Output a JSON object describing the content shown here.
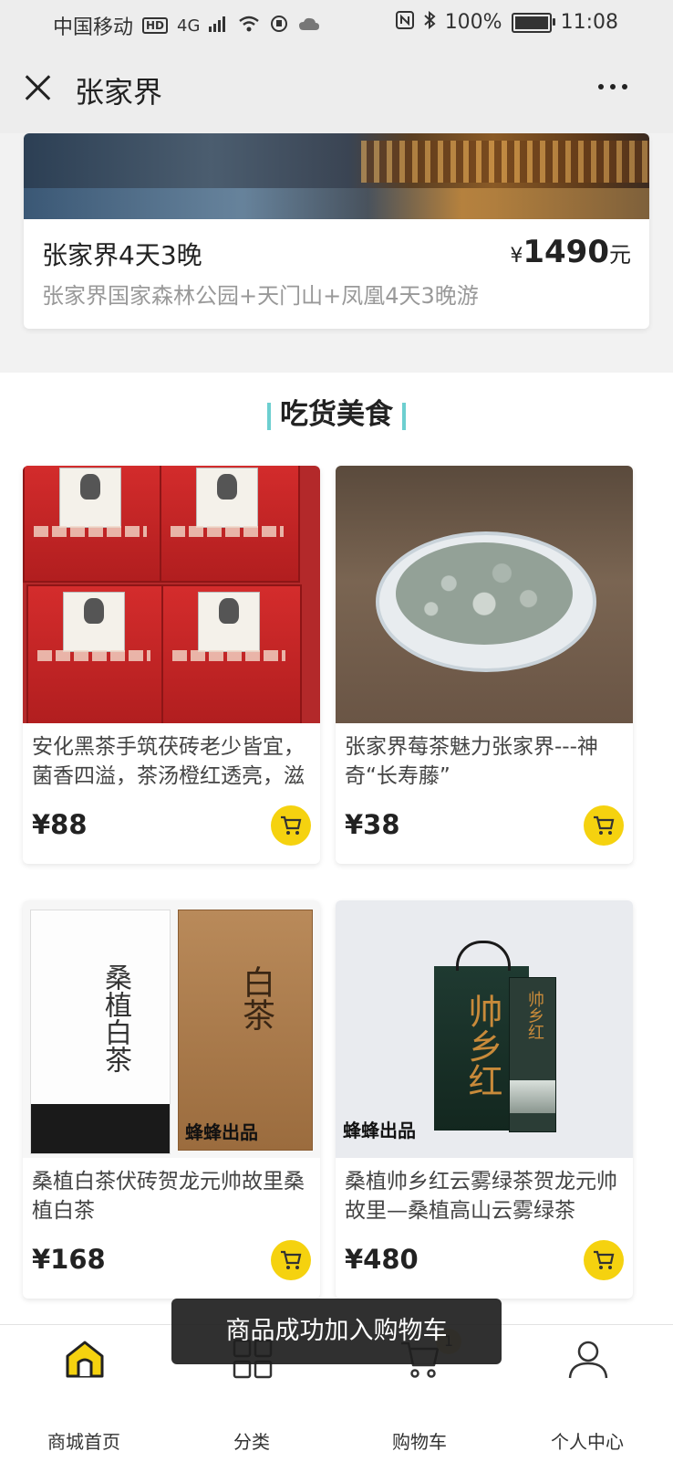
{
  "status_bar": {
    "carrier": "中国移动",
    "hd": "HD",
    "network": "4G",
    "battery": "100%",
    "time": "11:08"
  },
  "header": {
    "title": "张家界",
    "close_icon": "close-icon",
    "more_icon": "more-icon"
  },
  "tour": {
    "name": "张家界4天3晚",
    "currency": "¥",
    "price": "1490",
    "unit": "元",
    "desc": "张家界国家森林公园+天门山+凤凰4天3晚游"
  },
  "section": {
    "title": "吃货美食",
    "accent": "#6dcfd0"
  },
  "products": [
    {
      "name": "安化黑茶手筑茯砖老少皆宜，菌香四溢，茶汤橙红透亮，滋",
      "price": "¥88"
    },
    {
      "name": "张家界莓茶魅力张家界---神奇“长寿藤”",
      "price": "¥38"
    },
    {
      "name": "桑植白茶伏砖贺龙元帅故里桑植白茶",
      "price": "¥168"
    },
    {
      "name": "桑植帅乡红云雾绿茶贺龙元帅故里—桑植高山云雾绿茶",
      "price": "¥480"
    }
  ],
  "product_image_text": {
    "box_title": "手筑茯砖",
    "white_tea": "桑植白茶",
    "kraft_tea": "白茶",
    "stamp": "蜂蜂出品",
    "gift": "帅乡红"
  },
  "toast": "商品成功加入购物车",
  "tabs": [
    {
      "label": "商城首页",
      "icon": "home-icon"
    },
    {
      "label": "分类",
      "icon": "grid-icon"
    },
    {
      "label": "购物车",
      "icon": "cart-icon",
      "badge": "1"
    },
    {
      "label": "个人中心",
      "icon": "user-icon"
    }
  ],
  "colors": {
    "cart_button": "#f5d20f",
    "home_tab_active": "#f5d20f"
  }
}
